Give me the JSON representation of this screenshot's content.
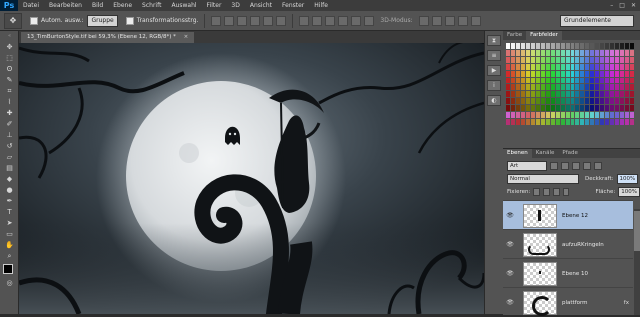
{
  "menubar": {
    "logo": "Ps",
    "items": [
      "Datei",
      "Bearbeiten",
      "Bild",
      "Ebene",
      "Schrift",
      "Auswahl",
      "Filter",
      "3D",
      "Ansicht",
      "Fenster",
      "Hilfe"
    ],
    "window_controls": [
      "–",
      "□",
      "✕"
    ]
  },
  "options": {
    "tool_icon": "move-icon",
    "auto_select_label": "Autom. ausw.:",
    "auto_select_value": "Gruppe",
    "transform_label": "Transformationsstrg.",
    "mode_3d": "3D-Modus:",
    "workspace": "Grundelemente"
  },
  "document": {
    "tab_title": "13_TimBurtonStyle.tif bei 59,3% (Ebene 12, RGB/8*) *",
    "close_icon": "×"
  },
  "panels": {
    "swatch_tabs": [
      "Farbe",
      "Farbfelder"
    ],
    "swatch_active": 1,
    "layer_tabs": [
      "Ebenen",
      "Kanäle",
      "Pfade"
    ],
    "layer_active": 0,
    "kind_filter": "Art",
    "blend_mode": "Normal",
    "opacity_label": "Deckkraft:",
    "opacity_value": "100%",
    "lock_label": "Fixieren:",
    "fill_label": "Fläche:",
    "fill_value": "100%"
  },
  "layers": [
    {
      "name": "Ebene 12",
      "selected": true,
      "fx": ""
    },
    {
      "name": "aufzuRKringeln",
      "selected": false,
      "fx": ""
    },
    {
      "name": "Ebene 10",
      "selected": false,
      "fx": ""
    },
    {
      "name": "plattform",
      "selected": false,
      "fx": "fx"
    }
  ],
  "colors": {
    "accent_selection": "#a7bedd",
    "canvas_bg": "#232a30",
    "ui_panel": "#535353"
  }
}
